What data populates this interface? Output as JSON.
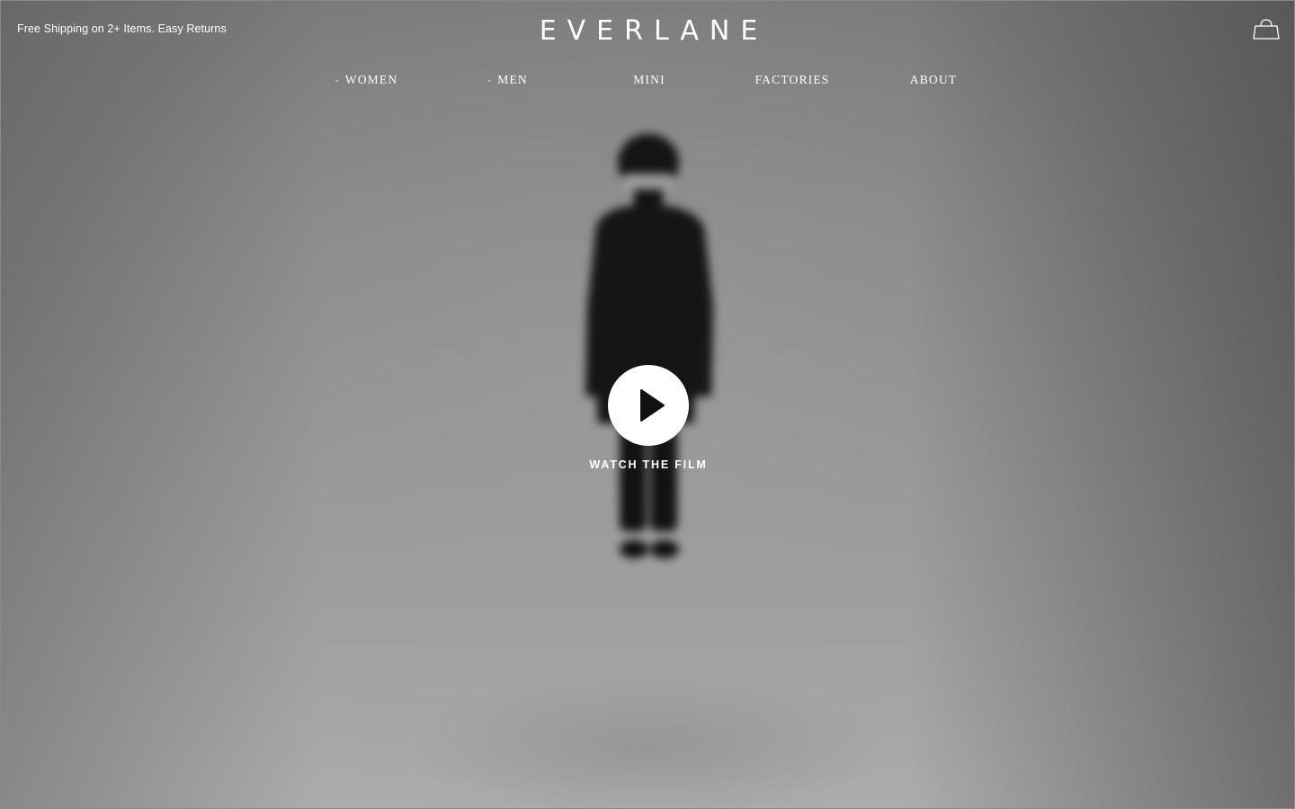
{
  "header": {
    "promo_text": "Free Shipping on 2+ Items. Easy Returns",
    "logo": "EVERLANE",
    "cart_icon": "shopping-bag-icon"
  },
  "nav": {
    "items": [
      {
        "label": "WOMEN",
        "has_dropdown": true
      },
      {
        "label": "MEN",
        "has_dropdown": true
      },
      {
        "label": "MINI",
        "has_dropdown": false
      },
      {
        "label": "FACTORIES",
        "has_dropdown": false
      },
      {
        "label": "ABOUT",
        "has_dropdown": false
      }
    ],
    "dropdown_glyph": "⌄"
  },
  "hero": {
    "play_icon": "play-icon",
    "cta_label": "WATCH THE FILM"
  },
  "colors": {
    "text": "#ffffff",
    "play_button_bg": "#ffffff",
    "play_glyph": "#111111"
  }
}
